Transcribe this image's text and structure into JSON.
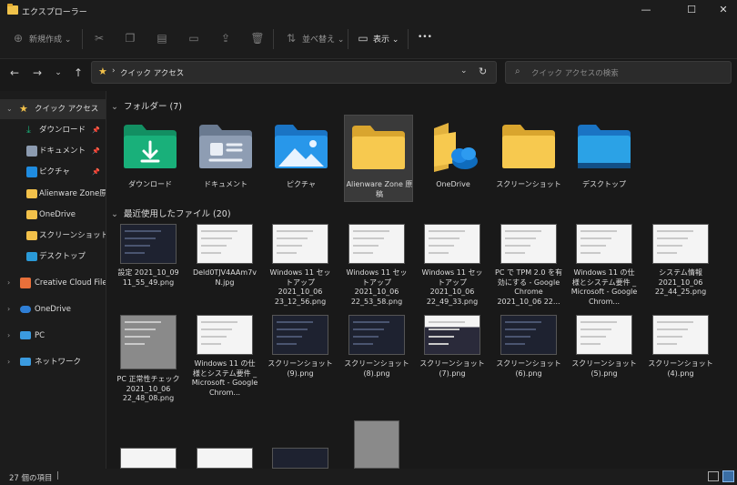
{
  "window": {
    "title": "エクスプローラー",
    "minimize": "—",
    "maximize": "☐",
    "close": "✕"
  },
  "toolbar": {
    "new_label": "新規作成",
    "sort_label": "並べ替え",
    "view_label": "表示",
    "more_label": "•••"
  },
  "address": {
    "path_label": "クイック アクセス",
    "search_placeholder": "クイック アクセスの検索"
  },
  "sidebar": {
    "quick_access": "クイック アクセス",
    "items": [
      {
        "label": "ダウンロード",
        "pinned": true
      },
      {
        "label": "ドキュメント",
        "pinned": true
      },
      {
        "label": "ピクチャ",
        "pinned": true
      },
      {
        "label": "Alienware Zone原稿",
        "pinned": false
      },
      {
        "label": "OneDrive",
        "pinned": false
      },
      {
        "label": "スクリーンショット",
        "pinned": false
      },
      {
        "label": "デスクトップ",
        "pinned": false
      }
    ],
    "roots": [
      {
        "label": "Creative Cloud Files"
      },
      {
        "label": "OneDrive"
      },
      {
        "label": "PC"
      },
      {
        "label": "ネットワーク"
      }
    ]
  },
  "folders": {
    "header": "フォルダー (7)",
    "items": [
      {
        "label": "ダウンロード",
        "color": "#19a974"
      },
      {
        "label": "ドキュメント",
        "color": "#7f8da3"
      },
      {
        "label": "ピクチャ",
        "color": "#1f8ce0"
      },
      {
        "label": "Alienware Zone 原稿",
        "color": "#f2c14a"
      },
      {
        "label": "OneDrive",
        "color": "#f2c14a"
      },
      {
        "label": "スクリーンショット",
        "color": "#f2c14a"
      },
      {
        "label": "デスクトップ",
        "color": "#2a9ad8"
      }
    ]
  },
  "recent": {
    "header": "最近使用したファイル (20)",
    "items": [
      {
        "label": "設定 2021_10_09 11_55_49.png",
        "thumb": "dark"
      },
      {
        "label": "Deld0TJV4AAm7vN.jpg",
        "thumb": "light"
      },
      {
        "label": "Windows 11 セットアップ 2021_10_06 23_12_56.png",
        "thumb": "light"
      },
      {
        "label": "Windows 11 セットアップ 2021_10_06 22_53_58.png",
        "thumb": "light"
      },
      {
        "label": "Windows 11 セットアップ 2021_10_06 22_49_33.png",
        "thumb": "light"
      },
      {
        "label": "PC で TPM 2.0 を有効にする - Google Chrome 2021_10_06 22...",
        "thumb": "light"
      },
      {
        "label": "Windows 11 の仕様とシステム要件 _ Microsoft - Google Chrom...",
        "thumb": "light"
      },
      {
        "label": "システム情報 2021_10_06 22_44_25.png",
        "thumb": "light"
      },
      {
        "label": "PC 正常性チェック 2021_10_06 22_48_08.png",
        "thumb": "gray"
      },
      {
        "label": "Windows 11 の仕様とシステム要件 _ Microsoft - Google Chrom...",
        "thumb": "light"
      },
      {
        "label": "スクリーンショット (9).png",
        "thumb": "dark"
      },
      {
        "label": "スクリーンショット (8).png",
        "thumb": "dark"
      },
      {
        "label": "スクリーンショット (7).png",
        "thumb": "darklight"
      },
      {
        "label": "スクリーンショット (6).png",
        "thumb": "dark"
      },
      {
        "label": "スクリーンショット (5).png",
        "thumb": "light"
      },
      {
        "label": "スクリーンショット (4).png",
        "thumb": "light"
      }
    ],
    "partial_row_thumbs": [
      "light",
      "light",
      "dark",
      "gray"
    ]
  },
  "status": {
    "count": "27 個の項目"
  }
}
